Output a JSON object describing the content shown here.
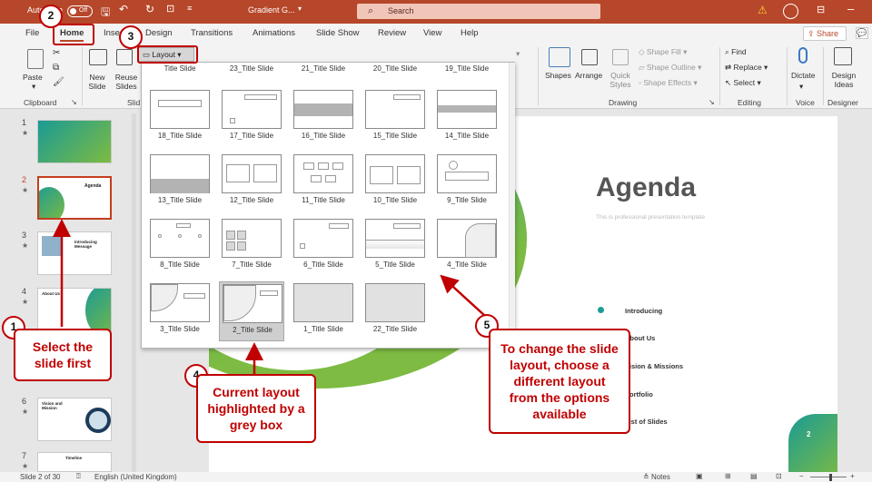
{
  "titlebar": {
    "autosave_label": "AutoSave",
    "autosave_state": "Off",
    "filename": "Gradient G...",
    "search_placeholder": "Search",
    "warning": "!",
    "user_initial": ""
  },
  "tabs": [
    {
      "label": "File"
    },
    {
      "label": "Home"
    },
    {
      "label": "Insert"
    },
    {
      "label": "Design"
    },
    {
      "label": "Transitions"
    },
    {
      "label": "Animations"
    },
    {
      "label": "Slide Show"
    },
    {
      "label": "Review"
    },
    {
      "label": "View"
    },
    {
      "label": "Help"
    }
  ],
  "share_label": "Share",
  "ribbon": {
    "paste": "Paste",
    "new_slide": "New Slide",
    "reuse_slides": "Reuse Slides",
    "layout": "Layout",
    "shapes": "Shapes",
    "arrange": "Arrange",
    "quick_styles": "Quick Styles",
    "shape_fill": "Shape Fill",
    "shape_outline": "Shape Outline",
    "shape_effects": "Shape Effects",
    "find": "Find",
    "replace": "Replace",
    "select": "Select",
    "dictate": "Dictate",
    "design_ideas": "Design Ideas",
    "groups": {
      "clipboard": "Clipboard",
      "slides": "Slid",
      "drawing": "Drawing",
      "editing": "Editing",
      "voice": "Voice",
      "designer": "Designer"
    }
  },
  "gallery": {
    "top_row": [
      "Title Slide",
      "23_Title Slide",
      "21_Title Slide",
      "20_Title Slide",
      "19_Title Slide"
    ],
    "rows": [
      [
        "18_Title Slide",
        "17_Title Slide",
        "16_Title Slide",
        "15_Title Slide",
        "14_Title Slide"
      ],
      [
        "13_Title Slide",
        "12_Title Slide",
        "11_Title Slide",
        "10_Title Slide",
        "9_Title Slide"
      ],
      [
        "8_Title Slide",
        "7_Title Slide",
        "6_Title Slide",
        "5_Title Slide",
        "4_Title Slide"
      ],
      [
        "3_Title Slide",
        "2_Title Slide",
        "1_Title Slide",
        "22_Title Slide"
      ]
    ],
    "selected": "2_Title Slide"
  },
  "thumbnails": [
    {
      "num": "1",
      "star": "★"
    },
    {
      "num": "2",
      "star": "★",
      "title": "Agenda"
    },
    {
      "num": "3",
      "star": "★",
      "title": "Introducing Message"
    },
    {
      "num": "4",
      "star": "★",
      "title": "About Us"
    },
    {
      "num": "6",
      "star": "★",
      "title": "Vision and Mission"
    },
    {
      "num": "7",
      "star": "★",
      "title": "Timeline"
    }
  ],
  "slide": {
    "title": "Agenda",
    "subtitle": "This is professional presentation template",
    "items": [
      "Introducing",
      "About Us",
      "Vision & Missions",
      "Portfolio",
      "List of Slides"
    ],
    "page_number": "2"
  },
  "status": {
    "slide_count": "Slide 2 of 30",
    "language": "English (United Kingdom)",
    "notes": "Notes"
  },
  "annotations": {
    "b1": "1",
    "b2": "2",
    "b3": "3",
    "b4": "4",
    "b5": "5",
    "c1": "Select the slide first",
    "c4": "Current layout highlighted by a grey box",
    "c5": "To change the slide layout, choose a different layout from the options available"
  },
  "colors": {
    "title_bar": "#b7472a",
    "annotation_red": "#c00000",
    "teal": "#1a9b94",
    "green": "#7dbb42"
  }
}
